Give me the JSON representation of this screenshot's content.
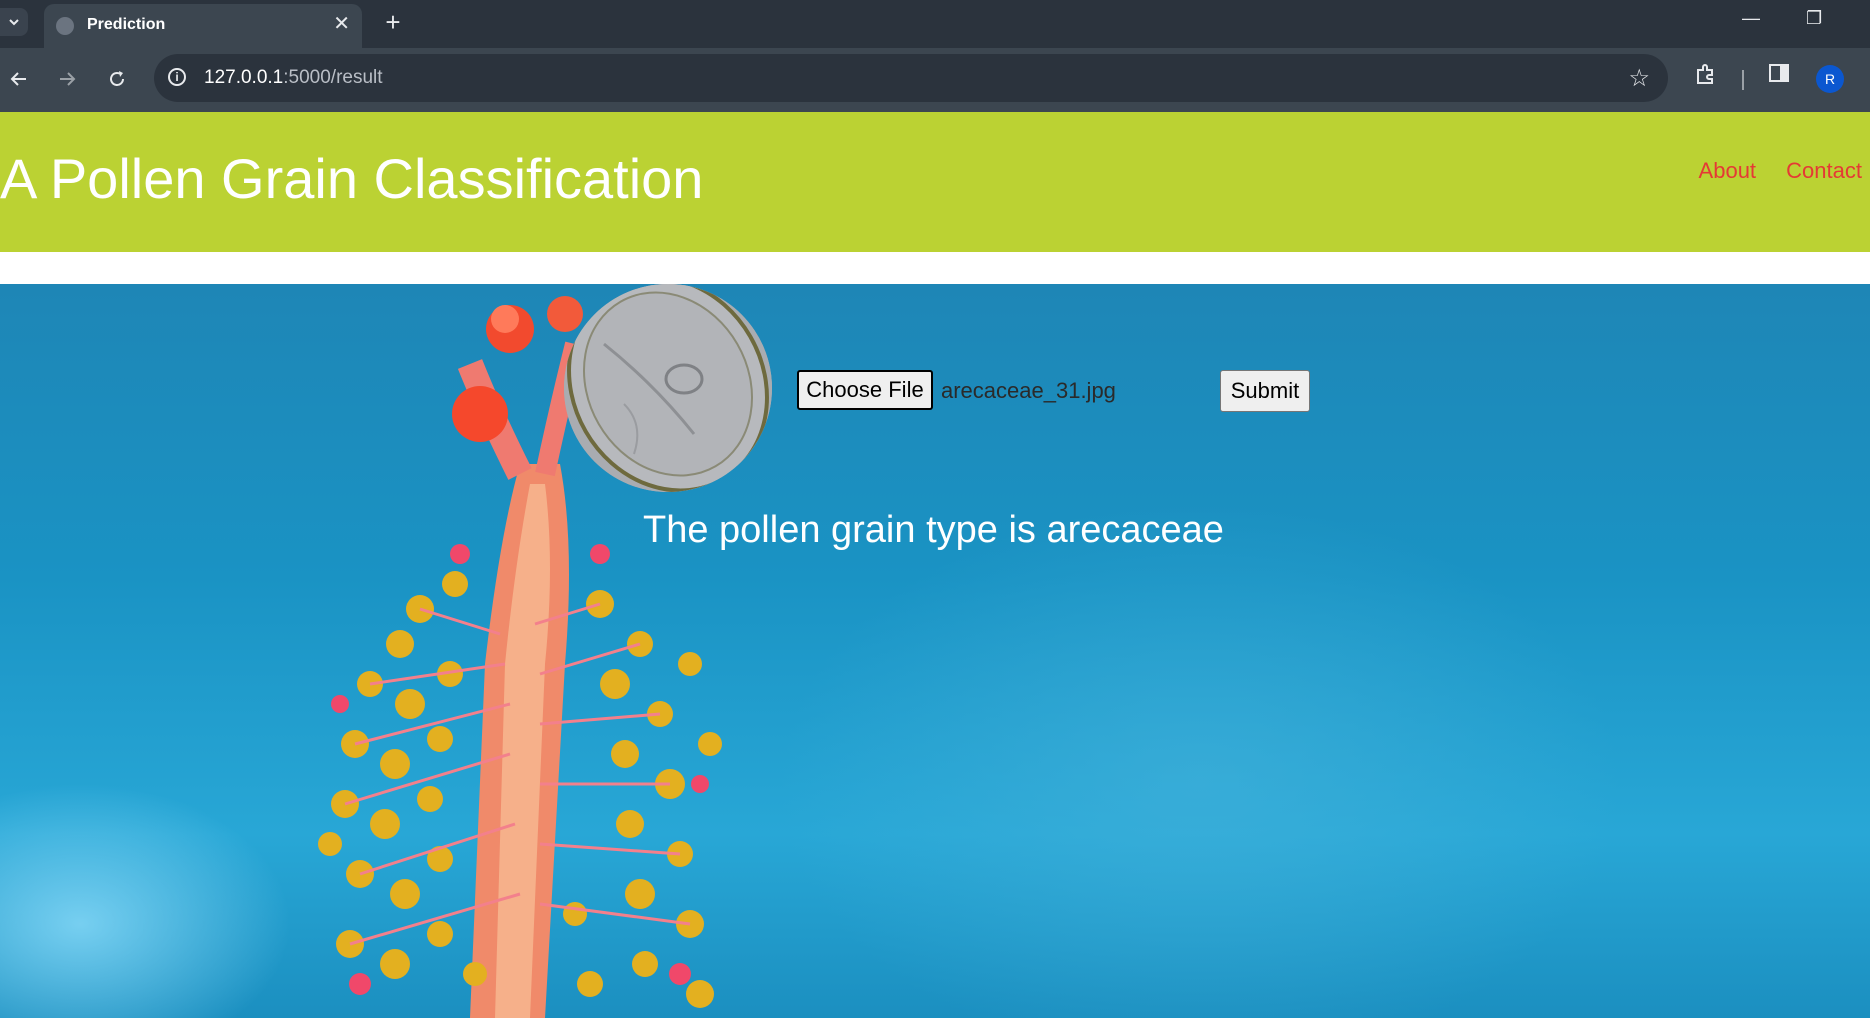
{
  "browser": {
    "tab_title": "Prediction",
    "url_host": "127.0.0.1",
    "url_path": ":5000/result",
    "profile_initial": "R"
  },
  "header": {
    "title": "A Pollen Grain Classification",
    "nav": [
      "About",
      "Contact"
    ],
    "background": "#bbd233",
    "nav_color": "#e53935"
  },
  "form": {
    "choose_label": "Choose File",
    "filename": "arecaceae_31.jpg",
    "submit_label": "Submit"
  },
  "result": {
    "text": "The pollen grain type is arecaceae"
  }
}
